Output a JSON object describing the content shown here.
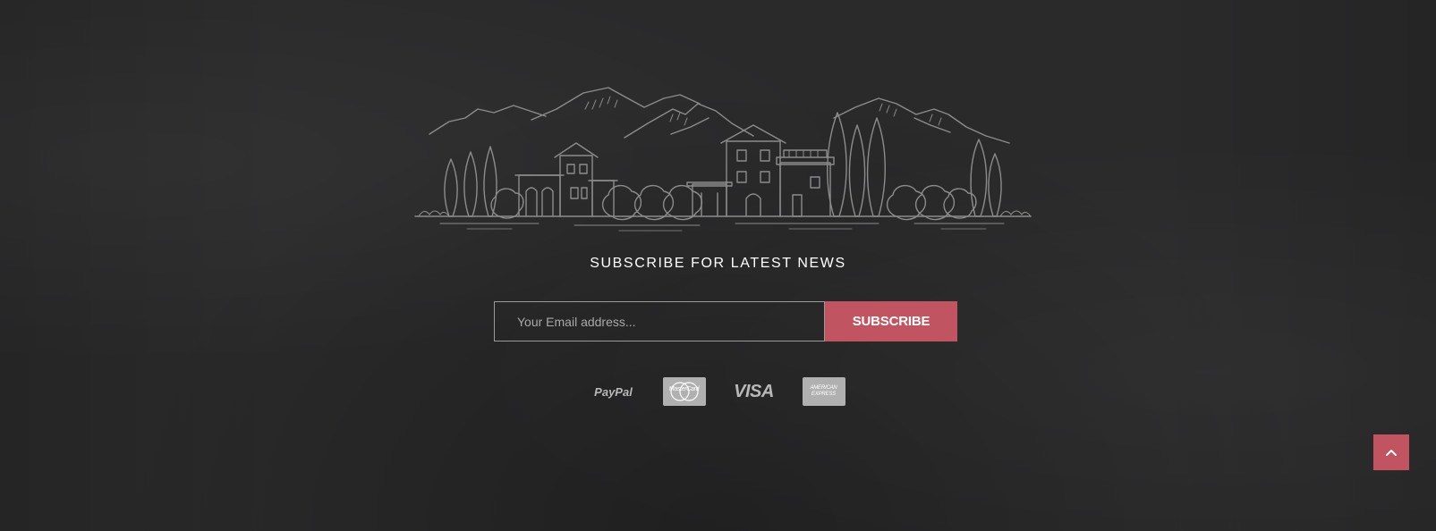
{
  "footer": {
    "heading": "SUBSCRIBE FOR LATEST NEWS",
    "email_placeholder": "Your Email address...",
    "subscribe_label": "SUBSCRIBE",
    "payments": {
      "paypal": "PayPal",
      "mastercard": "MasterCard",
      "visa": "VISA",
      "amex_line1": "AMERICAN",
      "amex_line2": "EXPRESS"
    },
    "icons": {
      "landscape": "village-landscape-illustration",
      "to_top": "chevron-up-icon"
    }
  },
  "colors": {
    "background": "#2a2a2b",
    "accent": "#c05460",
    "illustration": "#8c8c8c",
    "text": "#ffffff"
  }
}
